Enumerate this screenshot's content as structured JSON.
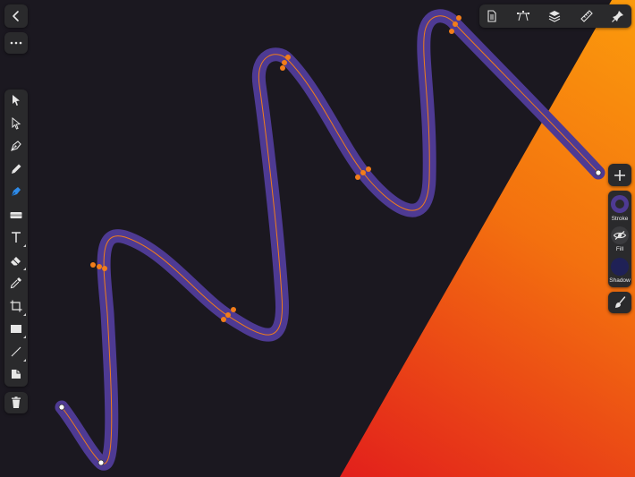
{
  "app": {
    "background_color": "#1b1820",
    "gradient_colors": [
      "#fb9a0c",
      "#e21f1c"
    ],
    "stroke_color": "#4e3a93",
    "path_color": "#f27d1a",
    "node_color": "#f27d1a",
    "endpoint_color": "#ffffff"
  },
  "top_left": {
    "back_icon": "chevron-left-icon",
    "more_icon": "ellipsis-icon"
  },
  "top_toolbar": {
    "items": [
      {
        "name": "document-icon"
      },
      {
        "name": "transform-icon"
      },
      {
        "name": "layers-icon"
      },
      {
        "name": "ruler-icon"
      },
      {
        "name": "pin-icon"
      }
    ]
  },
  "tools": {
    "items": [
      {
        "name": "selection-tool",
        "active": false
      },
      {
        "name": "node-selection-tool",
        "active": false
      },
      {
        "name": "pen-tool",
        "active": false
      },
      {
        "name": "pencil-tool",
        "active": false
      },
      {
        "name": "vector-brush-tool",
        "active": true
      },
      {
        "name": "fill-tool",
        "active": false
      },
      {
        "name": "text-tool",
        "active": false
      },
      {
        "name": "eraser-tool",
        "active": false
      },
      {
        "name": "eyedropper-tool",
        "active": false
      },
      {
        "name": "crop-tool",
        "active": false
      },
      {
        "name": "rectangle-tool",
        "active": false
      },
      {
        "name": "line-tool",
        "active": false
      },
      {
        "name": "corner-tool",
        "active": false
      }
    ],
    "active_color": "#2f8be8"
  },
  "trash": {
    "icon": "trash-icon"
  },
  "right_panel": {
    "add_icon": "plus-icon",
    "stroke": {
      "label": "Stroke",
      "color": "#4e3a93"
    },
    "fill": {
      "label": "Fill",
      "state": "none"
    },
    "shadow": {
      "label": "Shadow",
      "color": "#1f2156"
    },
    "brush_icon": "brush-icon"
  }
}
